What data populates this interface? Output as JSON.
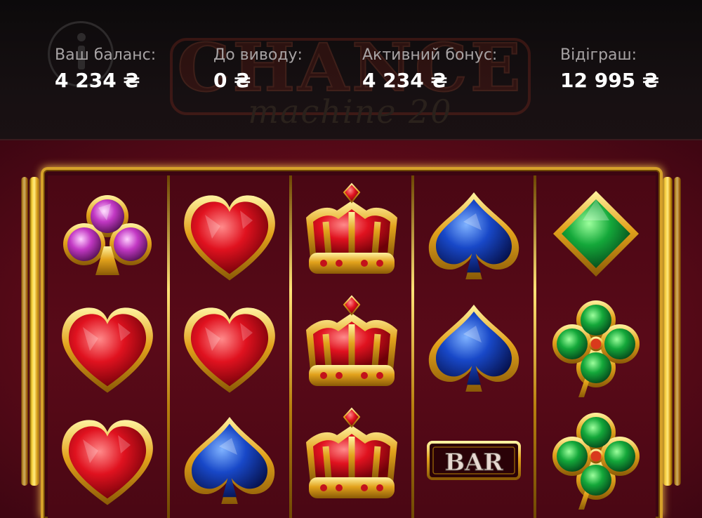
{
  "header": {
    "balance": {
      "label": "Ваш баланс:",
      "value": "4 234 ₴"
    },
    "withdrawable": {
      "label": "До виводу:",
      "value": "0 ₴"
    },
    "active_bonus": {
      "label": "Активний бонус:",
      "value": "4 234 ₴"
    },
    "wagering": {
      "label": "Відіграш:",
      "value": "12 995 ₴"
    },
    "info_icon": "info-icon"
  },
  "logo": {
    "title": "CHANCE",
    "subtitle": "machine 20"
  },
  "reels": [
    [
      "club-symbol",
      "heart-symbol",
      "heart-symbol"
    ],
    [
      "heart-symbol",
      "heart-symbol",
      "spade-symbol"
    ],
    [
      "crown-symbol",
      "crown-symbol",
      "crown-symbol"
    ],
    [
      "spade-symbol",
      "spade-symbol",
      "bar-symbol"
    ],
    [
      "diamond-symbol",
      "four-leaf-clover-symbol",
      "four-leaf-clover-symbol"
    ]
  ],
  "bar_text": "BAR",
  "colors": {
    "header_bg": "#120c0d",
    "game_bg": "#5a0a18",
    "gold": "#d6a12a",
    "label_gray": "#a7a3a4"
  }
}
